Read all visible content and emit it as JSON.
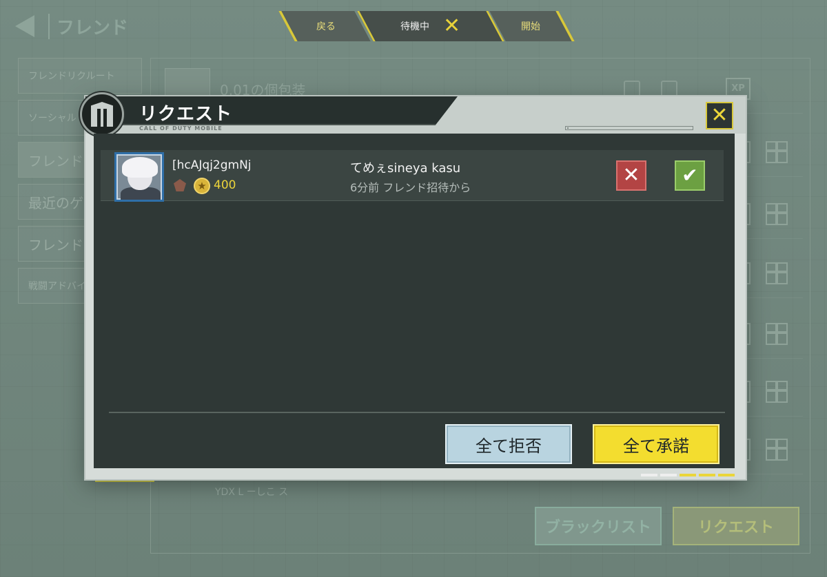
{
  "background": {
    "title": "フレンド",
    "sidebar": [
      "フレンドリクルート",
      "ソーシャル",
      "フレンド",
      "最近のゲ",
      "フレンドシ",
      "戦闘アドバイ"
    ],
    "first_friend_name": "0.01の個包装",
    "footer_text": "YDX L ーしこ ス",
    "blacklist_label": "ブラックリスト",
    "requests_label": "リクエスト"
  },
  "topbar": {
    "back_label": "戻る",
    "status_label": "待機中",
    "start_label": "開始"
  },
  "modal": {
    "title": "リクエスト",
    "brand": "CALL OF DUTY MOBILE",
    "requests": [
      {
        "name": "[hcAJqj2gmNj",
        "level": "400",
        "message": "てめぇsineya kasu",
        "time": "6分前 フレンド招待から"
      }
    ],
    "reject_all_label": "全て拒否",
    "accept_all_label": "全て承諾"
  },
  "colors": {
    "accent_yellow": "#f3dd2f",
    "reject_red": "#b34444",
    "accept_green": "#6ca042",
    "modal_body": "#2f3836"
  }
}
